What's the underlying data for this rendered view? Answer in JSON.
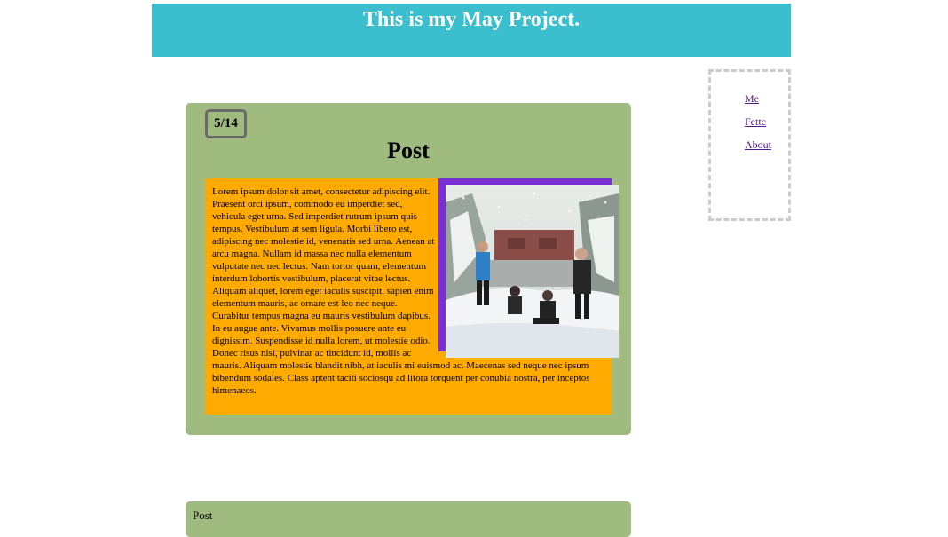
{
  "header": {
    "title": "This is my May Project."
  },
  "sidebar": {
    "links": [
      {
        "label": "Me"
      },
      {
        "label": "Fettc"
      },
      {
        "label": "About"
      }
    ]
  },
  "post": {
    "date": "5/14",
    "title": "Post",
    "body": "Lorem ipsum dolor sit amet, consectetur adipiscing elit. Praesent orci ipsum, commodo eu imperdiet sed, vehicula eget urna. Sed imperdiet rutrum ipsum quis tempus. Vestibulum at sem ligula. Morbi libero est, adipiscing nec molestie id, venenatis sed urna. Aenean at arcu magna. Nullam id massa nec nulla elementum vulputate nec nec lectus. Nam tortor quam, elementum interdum lobortis vestibulum, placerat vitae lectus. Aliquam aliquet, lorem eget iaculis suscipit, sapien enim elementum mauris, ac ornare est leo nec neque. Curabitur tempus magna eu mauris vestibulum dapibus. In eu augue ante. Vivamus mollis posuere ante eu dignissim. Suspendisse id nulla lorem, ut molestie odio. Donec risus nisi, pulvinar ac tincidunt id, mollis ac mauris. Aliquam molestie blandit nibh, at iaculis mi euismod ac. Maecenas sed neque nec ipsum bibendum sodales. Class aptent taciti sociosqu ad litora torquent per conubia nostra, per inceptos himenaeos.",
    "photo_description": "snow-photo"
  },
  "post2": {
    "title": "Post"
  },
  "colors": {
    "header_bg": "#3bbfcf",
    "post_bg": "#9fbb80",
    "content_bg": "#ffaa00",
    "photo_frame": "#7a2fd6",
    "link": "#551a8b"
  }
}
